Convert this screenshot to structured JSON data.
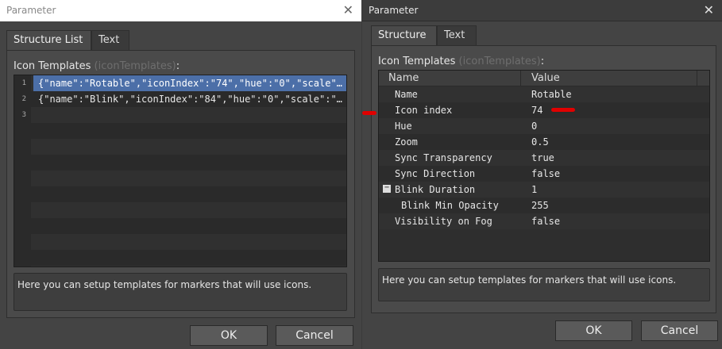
{
  "left": {
    "title": "Parameter",
    "tabs": [
      "Structure List",
      "Text"
    ],
    "section_label": "Icon Templates",
    "section_sub": "(iconTemplates)",
    "section_suffix": ":",
    "rows": [
      {
        "n": "1",
        "text": "{\"name\":\"Rotable\",\"iconIndex\":\"74\",\"hue\":\"0\",\"scale\"…"
      },
      {
        "n": "2",
        "text": "{\"name\":\"Blink\",\"iconIndex\":\"84\",\"hue\":\"0\",\"scale\":\"…"
      },
      {
        "n": "3",
        "text": ""
      }
    ],
    "help": "Here you can setup templates for markers that will use icons.",
    "ok": "OK",
    "cancel": "Cancel"
  },
  "right": {
    "title": "Parameter",
    "tabs": [
      "Structure",
      "Text"
    ],
    "section_label": "Icon Templates",
    "section_sub": "(iconTemplates)",
    "section_suffix": ":",
    "col_name": "Name",
    "col_value": "Value",
    "props": [
      {
        "name": "Name",
        "value": "Rotable"
      },
      {
        "name": "Icon index",
        "value": "74"
      },
      {
        "name": "Hue",
        "value": "0"
      },
      {
        "name": "Zoom",
        "value": "0.5"
      },
      {
        "name": "Sync Transparency",
        "value": "true"
      },
      {
        "name": "Sync Direction",
        "value": "false"
      },
      {
        "name": "Blink Duration",
        "value": "1"
      },
      {
        "name": "Blink Min Opacity",
        "value": "255"
      },
      {
        "name": "Visibility on Fog",
        "value": "false"
      }
    ],
    "expander_glyph": "−",
    "help": "Here you can setup templates for markers that will use icons.",
    "ok": "OK",
    "cancel": "Cancel"
  },
  "icons": {
    "close": "close-icon"
  },
  "colors": {
    "selection": "#4c6fa8",
    "annotation": "#e00000"
  }
}
